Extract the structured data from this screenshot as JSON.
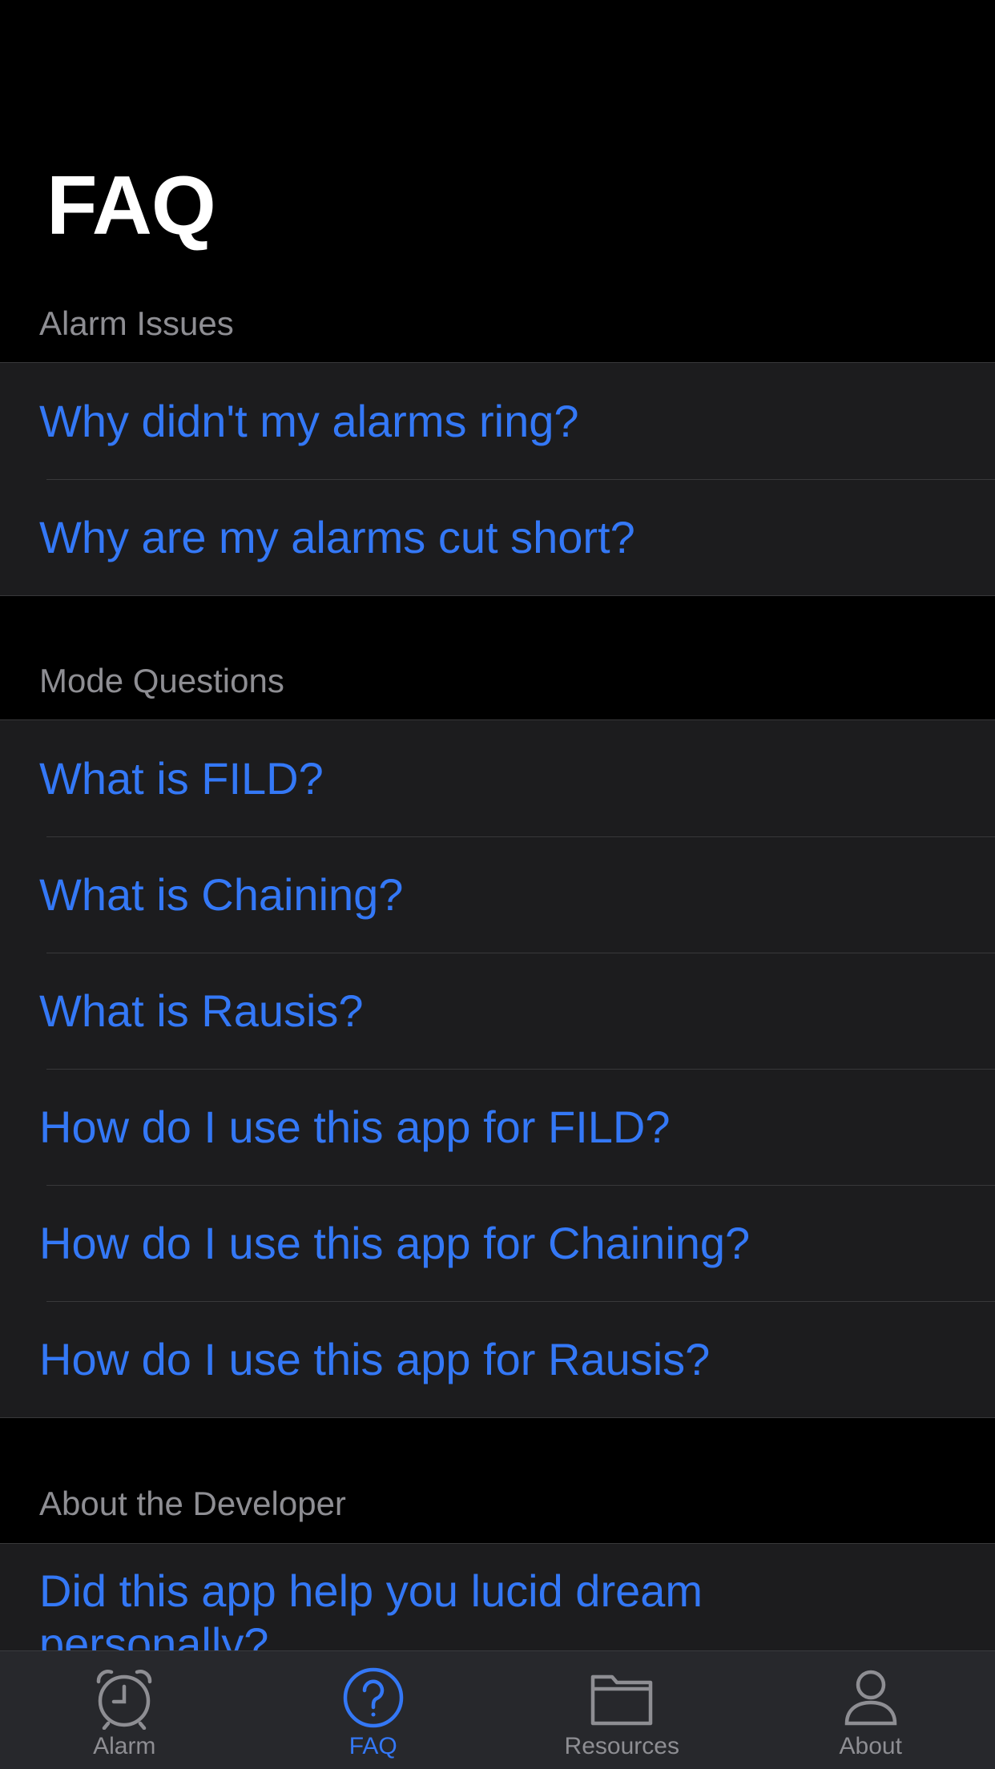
{
  "header": {
    "title": "FAQ"
  },
  "sections": [
    {
      "title": "Alarm Issues",
      "items": [
        "Why didn't my alarms ring?",
        "Why are my alarms cut short?"
      ]
    },
    {
      "title": "Mode Questions",
      "items": [
        "What is FILD?",
        "What is Chaining?",
        "What is Rausis?",
        "How do I use this app for FILD?",
        "How do I use this app for Chaining?",
        "How do I use this app for Rausis?"
      ]
    },
    {
      "title": "About the Developer",
      "items": [
        "Did this app help you lucid dream personally?"
      ]
    }
  ],
  "tabbar": {
    "active": "FAQ",
    "items": [
      {
        "label": "Alarm",
        "icon": "alarm-clock-icon"
      },
      {
        "label": "FAQ",
        "icon": "question-circle-icon"
      },
      {
        "label": "Resources",
        "icon": "folder-icon"
      },
      {
        "label": "About",
        "icon": "person-icon"
      }
    ]
  },
  "colors": {
    "background": "#000000",
    "cell": "#1c1c1e",
    "accent": "#3478f6",
    "secondary_text": "#8e8e93",
    "tabbar": "#27282c"
  }
}
